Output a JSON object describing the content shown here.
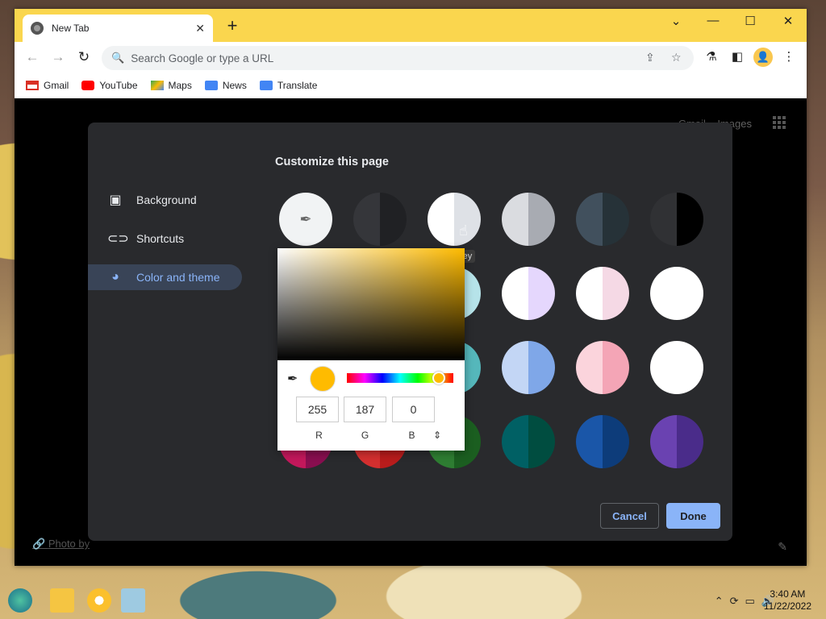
{
  "browser": {
    "tab_title": "New Tab",
    "omnibox_placeholder": "Search Google or type a URL",
    "bookmarks": [
      {
        "label": "Gmail",
        "icon": "gmail-icon"
      },
      {
        "label": "YouTube",
        "icon": "youtube-icon"
      },
      {
        "label": "Maps",
        "icon": "maps-icon"
      },
      {
        "label": "News",
        "icon": "news-icon"
      },
      {
        "label": "Translate",
        "icon": "translate-icon"
      }
    ]
  },
  "ntp": {
    "gmail_link": "Gmail",
    "images_link": "Images",
    "photo_credit": "Photo by"
  },
  "customize": {
    "title": "Customize this page",
    "nav": [
      {
        "label": "Background",
        "icon": "image-icon"
      },
      {
        "label": "Shortcuts",
        "icon": "link-icon"
      },
      {
        "label": "Color and theme",
        "icon": "palette-icon",
        "selected": true
      }
    ],
    "hover_tooltip": "rey",
    "cancel_label": "Cancel",
    "done_label": "Done",
    "swatches": [
      {
        "left": "#f1f3f4",
        "right": "#f1f3f4",
        "custom": true
      },
      {
        "left": "#35363a",
        "right": "#202124"
      },
      {
        "left": "#ffffff",
        "right": "#dee1e6"
      },
      {
        "left": "#dadce0",
        "right": "#a8abb2"
      },
      {
        "left": "#41505d",
        "right": "#263238"
      },
      {
        "left": "#303134",
        "right": "#000000"
      },
      {
        "left": "#ffffff",
        "right": "#ffffff"
      },
      {
        "left": "#ffffff",
        "right": "#e6f4d7"
      },
      {
        "left": "#ffffff",
        "right": "#b6e3e9"
      },
      {
        "left": "#ffffff",
        "right": "#e5d7fd"
      },
      {
        "left": "#ffffff",
        "right": "#f5d9e5"
      },
      {
        "left": "#ffffff",
        "right": "#ffffff"
      },
      {
        "left": "#ffffff",
        "right": "#ffffff"
      },
      {
        "left": "#a3d9a4",
        "right": "#6fc38d"
      },
      {
        "left": "#a9dad6",
        "right": "#55b7bb"
      },
      {
        "left": "#c3d6f5",
        "right": "#7fa7e8"
      },
      {
        "left": "#fbd4dc",
        "right": "#f4a5b6"
      },
      {
        "left": "#ffffff",
        "right": "#ffffff"
      },
      {
        "left": "#c2185b",
        "right": "#880e4f"
      },
      {
        "left": "#d32f2f",
        "right": "#b71c1c"
      },
      {
        "left": "#2e7d32",
        "right": "#1b5e20"
      },
      {
        "left": "#006064",
        "right": "#004d40"
      },
      {
        "left": "#1a56a8",
        "right": "#0d3c7a"
      },
      {
        "left": "#6a42b1",
        "right": "#4a2c8a"
      }
    ]
  },
  "color_picker": {
    "current_color": "#ffbb00",
    "hue_color": "#ffbb00",
    "r": "255",
    "g": "187",
    "b": "0",
    "r_label": "R",
    "g_label": "G",
    "b_label": "B",
    "mode_toggle": "⇕"
  },
  "taskbar": {
    "time": "3:40 AM",
    "date": "11/22/2022"
  }
}
